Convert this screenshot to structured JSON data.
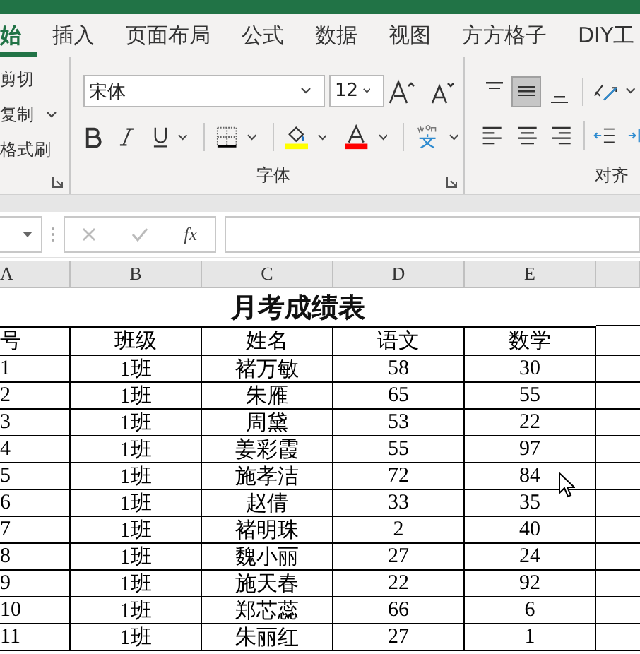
{
  "tabs": [
    {
      "label": "始",
      "selected": true
    },
    {
      "label": "插入",
      "selected": false
    },
    {
      "label": "页面布局",
      "selected": false
    },
    {
      "label": "公式",
      "selected": false
    },
    {
      "label": "数据",
      "selected": false
    },
    {
      "label": "视图",
      "selected": false
    },
    {
      "label": "方方格子",
      "selected": false
    },
    {
      "label": "DIY工",
      "selected": false
    }
  ],
  "clipboard": {
    "items": [
      "剪切",
      "复制",
      "格式刷"
    ]
  },
  "font_group": {
    "font_name": "宋体",
    "font_size": "12",
    "label": "字体"
  },
  "alignment_group": {
    "label": "对齐",
    "buttons": [
      {
        "kind": "top",
        "selected": false
      },
      {
        "kind": "middle",
        "selected": true
      },
      {
        "kind": "bottom",
        "selected": false
      }
    ]
  },
  "formula_bar": {
    "function_label": "fx"
  },
  "sheet": {
    "columns": [
      "A",
      "B",
      "C",
      "D",
      "E"
    ],
    "title": "月考成绩表",
    "header": [
      "号",
      "班级",
      "姓名",
      "语文",
      "数学"
    ],
    "rows": [
      [
        "1",
        "1班",
        "褚万敏",
        "58",
        "30"
      ],
      [
        "2",
        "1班",
        "朱雁",
        "65",
        "55"
      ],
      [
        "3",
        "1班",
        "周黛",
        "53",
        "22"
      ],
      [
        "4",
        "1班",
        "姜彩霞",
        "55",
        "97"
      ],
      [
        "5",
        "1班",
        "施孝洁",
        "72",
        "84"
      ],
      [
        "6",
        "1班",
        "赵倩",
        "33",
        "35"
      ],
      [
        "7",
        "1班",
        "褚明珠",
        "2",
        "40"
      ],
      [
        "8",
        "1班",
        "魏小丽",
        "27",
        "24"
      ],
      [
        "9",
        "1班",
        "施天春",
        "22",
        "92"
      ],
      [
        "10",
        "1班",
        "郑芯蕊",
        "66",
        "6"
      ],
      [
        "11",
        "1班",
        "朱丽红",
        "27",
        "1"
      ]
    ]
  }
}
